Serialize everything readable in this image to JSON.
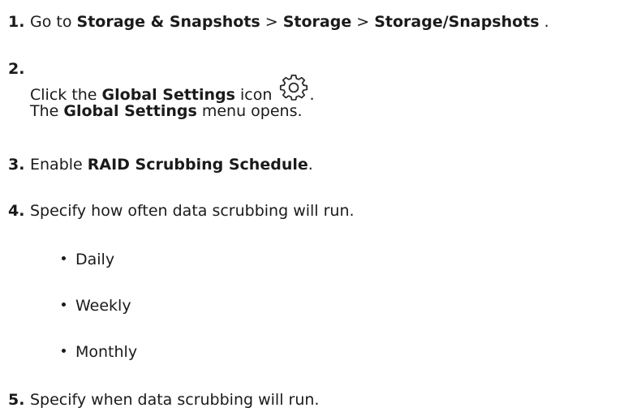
{
  "steps": [
    {
      "number": "1.",
      "go_to": "Go to ",
      "path1": "Storage & Snapshots",
      "sep1": " > ",
      "path2": "Storage",
      "sep2": " > ",
      "path3": "Storage/Snapshots",
      "end": " ."
    },
    {
      "number": "2.",
      "click_prefix": "Click the ",
      "global_settings": "Global Settings",
      "icon_word": " icon ",
      "icon_name": "gear-icon",
      "period": ".",
      "the_prefix": "The ",
      "global_settings2": "Global Settings",
      "menu_opens": " menu opens."
    },
    {
      "number": "3.",
      "enable": "Enable ",
      "raid": "RAID Scrubbing Schedule",
      "period": "."
    },
    {
      "number": "4.",
      "text": "Specify how often data scrubbing will run.",
      "options": [
        "Daily",
        "Weekly",
        "Monthly"
      ]
    },
    {
      "number": "5.",
      "text": "Specify when data scrubbing will run."
    }
  ]
}
